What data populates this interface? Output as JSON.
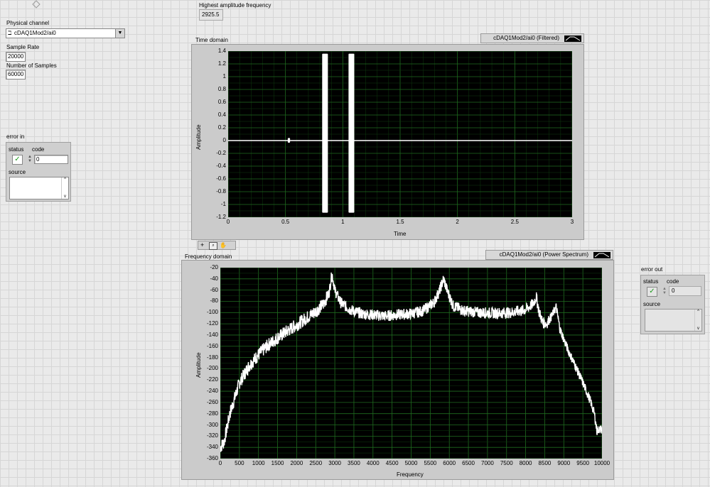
{
  "controls": {
    "physical_channel": {
      "label": "Physical channel",
      "value": "cDAQ1Mod2/ai0"
    },
    "sample_rate": {
      "label": "Sample Rate",
      "value": "20000"
    },
    "num_samples": {
      "label": "Number of Samples",
      "value": "60000"
    }
  },
  "indicator": {
    "label": "Highest amplitude frequency",
    "value": "2925.5"
  },
  "error_in": {
    "title": "error in",
    "status_label": "status",
    "code_label": "code",
    "code_value": "0",
    "source_label": "source"
  },
  "error_out": {
    "title": "error out",
    "status_label": "status",
    "code_label": "code",
    "code_value": "0",
    "source_label": "source"
  },
  "time_graph": {
    "title": "Time domain",
    "legend": "cDAQ1Mod2/ai0 (Filtered)",
    "xlabel": "Time",
    "ylabel": "Amplitude",
    "yticks": [
      "1.4",
      "1.2",
      "1",
      "0.8",
      "0.6",
      "0.4",
      "0.2",
      "0",
      "-0.2",
      "-0.4",
      "-0.6",
      "-0.8",
      "-1",
      "-1.2"
    ],
    "xticks": [
      "0",
      "0.5",
      "1",
      "1.5",
      "2",
      "2.5",
      "3"
    ]
  },
  "freq_graph": {
    "title": "Frequency domain",
    "legend": "cDAQ1Mod2/ai0 (Power Spectrum)",
    "xlabel": "Frequency",
    "ylabel": "Amplitude",
    "yticks": [
      "-20",
      "-40",
      "-60",
      "-80",
      "-100",
      "-120",
      "-140",
      "-160",
      "-180",
      "-200",
      "-220",
      "-240",
      "-260",
      "-280",
      "-300",
      "-320",
      "-340",
      "-360"
    ],
    "xticks": [
      "0",
      "500",
      "1000",
      "1500",
      "2000",
      "2500",
      "3000",
      "3500",
      "4000",
      "4500",
      "5000",
      "5500",
      "6000",
      "6500",
      "7000",
      "7500",
      "8000",
      "8500",
      "9000",
      "9500",
      "10000"
    ]
  },
  "chart_data": [
    {
      "type": "line",
      "title": "Time domain",
      "xlabel": "Time",
      "ylabel": "Amplitude",
      "xlim": [
        0,
        3
      ],
      "ylim": [
        -1.2,
        1.4
      ],
      "series": [
        {
          "name": "cDAQ1Mod2/ai0 (Filtered)",
          "bursts": [
            {
              "x_start": 0.52,
              "x_end": 0.54,
              "amplitude": 0.04
            },
            {
              "x_start": 0.82,
              "x_end": 0.87,
              "amplitude": 1.36
            },
            {
              "x_start": 1.05,
              "x_end": 1.1,
              "amplitude": 1.36
            }
          ],
          "baseline": 0
        }
      ],
      "grid": true
    },
    {
      "type": "line",
      "title": "Frequency domain",
      "xlabel": "Frequency",
      "ylabel": "Amplitude",
      "xlim": [
        0,
        10000
      ],
      "ylim": [
        -360,
        -20
      ],
      "series": [
        {
          "name": "cDAQ1Mod2/ai0 (Power Spectrum)",
          "x": [
            0,
            100,
            250,
            500,
            750,
            1000,
            1250,
            1500,
            1750,
            2000,
            2250,
            2500,
            2700,
            2850,
            2925,
            3000,
            3150,
            3400,
            3700,
            4000,
            4300,
            4600,
            5000,
            5300,
            5600,
            5750,
            5850,
            5950,
            6100,
            6400,
            6800,
            7200,
            7600,
            8000,
            8200,
            8280,
            8350,
            8450,
            8550,
            8700,
            8800,
            8900,
            9100,
            9300,
            9500,
            9700,
            9800,
            9870,
            9900,
            10000
          ],
          "y": [
            -340,
            -330,
            -280,
            -225,
            -195,
            -175,
            -158,
            -145,
            -133,
            -122,
            -110,
            -98,
            -85,
            -65,
            -30,
            -60,
            -82,
            -95,
            -102,
            -104,
            -106,
            -104,
            -102,
            -97,
            -82,
            -60,
            -40,
            -62,
            -88,
            -97,
            -100,
            -101,
            -100,
            -95,
            -84,
            -72,
            -98,
            -118,
            -120,
            -104,
            -90,
            -130,
            -165,
            -195,
            -225,
            -258,
            -280,
            -312,
            -308,
            -308
          ]
        }
      ],
      "grid": true
    }
  ]
}
